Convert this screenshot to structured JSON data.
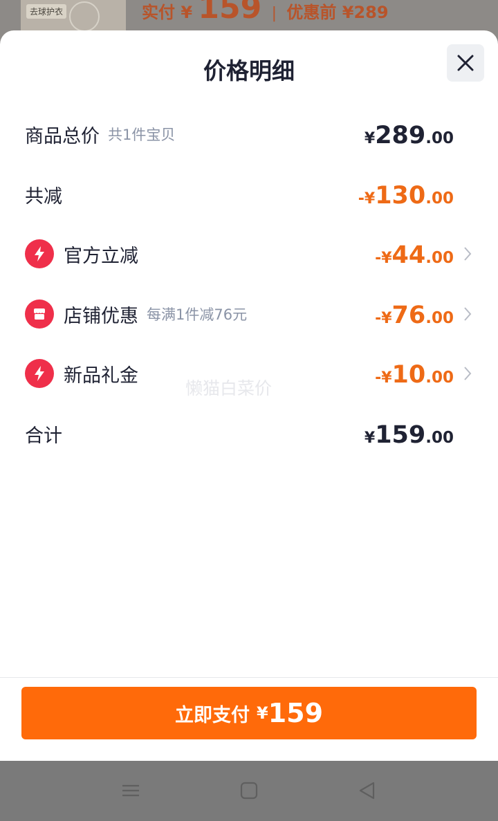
{
  "background": {
    "thumb_tag": "去球护衣",
    "actual_label": "实付",
    "actual_yen": "¥",
    "actual_price": "159",
    "separator": "|",
    "before_label": "优惠前",
    "before_price": "¥289"
  },
  "sheet": {
    "title": "价格明细",
    "close_icon": "close-icon"
  },
  "rows": [
    {
      "label": "商品总价",
      "sub": "共1件宝贝",
      "yen": "¥",
      "int": "289",
      "dec": ".00",
      "tone": "dark",
      "has_chevron": false
    },
    {
      "label": "共减",
      "sub": "",
      "yen": "-¥",
      "int": "130",
      "dec": ".00",
      "tone": "orange",
      "has_chevron": false
    },
    {
      "label": "官方立减",
      "sub": "",
      "icon": "lightning-icon",
      "yen": "-¥",
      "int": "44",
      "dec": ".00",
      "tone": "orange",
      "has_chevron": true
    },
    {
      "label": "店铺优惠",
      "sub": "每满1件减76元",
      "icon": "shop-icon",
      "yen": "-¥",
      "int": "76",
      "dec": ".00",
      "tone": "orange",
      "has_chevron": true
    },
    {
      "label": "新品礼金",
      "sub": "",
      "icon": "lightning-icon",
      "yen": "-¥",
      "int": "10",
      "dec": ".00",
      "tone": "orange",
      "has_chevron": true
    },
    {
      "label": "合计",
      "sub": "",
      "yen": "¥",
      "int": "159",
      "dec": ".00",
      "tone": "dark",
      "has_chevron": false
    }
  ],
  "watermark": "懒猫白菜价",
  "pay_button": {
    "label": "立即支付",
    "yen": "¥",
    "amount": "159"
  },
  "colors": {
    "accent": "#ff6a0a",
    "discount": "#ee6a16",
    "icon_red": "#ef2f4a",
    "text_dark": "#1f2233",
    "text_muted": "#8a93a6"
  },
  "navbar": {
    "icons": [
      "menu-icon",
      "home-icon",
      "back-icon"
    ]
  }
}
